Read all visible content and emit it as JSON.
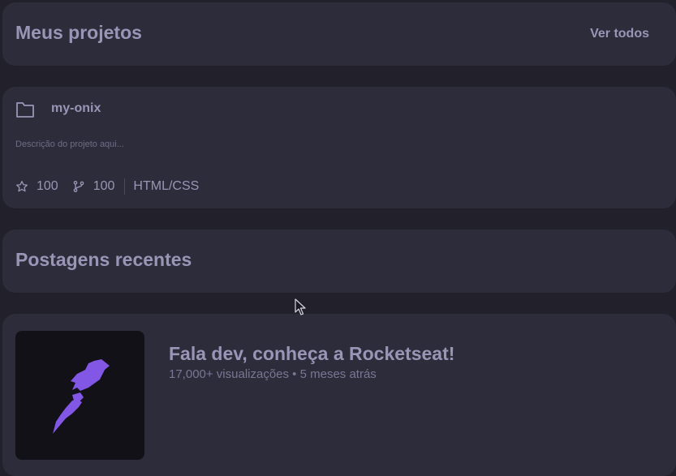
{
  "projects_header": {
    "title": "Meus projetos",
    "see_all_label": "Ver todos"
  },
  "project": {
    "name": "my-onix",
    "description": "Descrição do projeto aqui...",
    "stars": "100",
    "forks": "100",
    "language": "HTML/CSS"
  },
  "posts_header": {
    "title": "Postagens recentes"
  },
  "post": {
    "title": "Fala dev, conheça a Rocketseat!",
    "meta": "17,000+ visualizações • 5 meses atrás",
    "thumbnail_icon": "rocket-logo"
  },
  "colors": {
    "background": "#21202b",
    "card": "#2d2c3a",
    "text": "#9a95b6",
    "accent": "#8257e5"
  }
}
